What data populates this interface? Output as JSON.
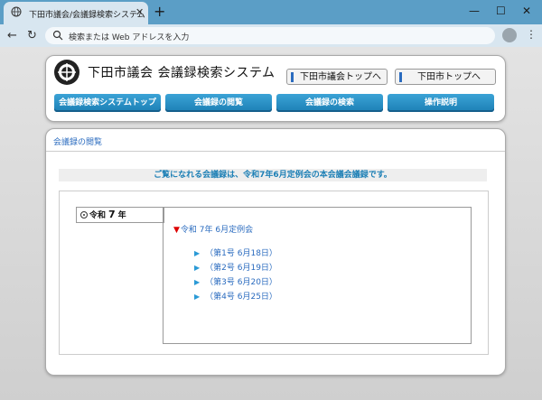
{
  "browser": {
    "tab_title": "下田市議会/会議録検索システム",
    "address_placeholder": "検索または Web アドレスを入力"
  },
  "header": {
    "site_title": "下田市議会 会議録検索システム",
    "buttons": [
      "下田市議会トップへ",
      "下田市トップへ"
    ],
    "nav": [
      "会議録検索システムトップ",
      "会議録の閲覧",
      "会議録の検索",
      "操作説明"
    ]
  },
  "content": {
    "section_title": "会議録の閲覧",
    "notice": "ご覧になれる会議録は、令和7年6月定例会の本会議会議録です。",
    "year": {
      "era": "令和",
      "number": "7",
      "suffix": "年"
    },
    "session": "令和 7年 6月定例会",
    "issues": [
      "（第1号 6月18日）",
      "（第2号 6月19日）",
      "（第3号 6月20日）",
      "（第4号 6月25日）"
    ]
  }
}
